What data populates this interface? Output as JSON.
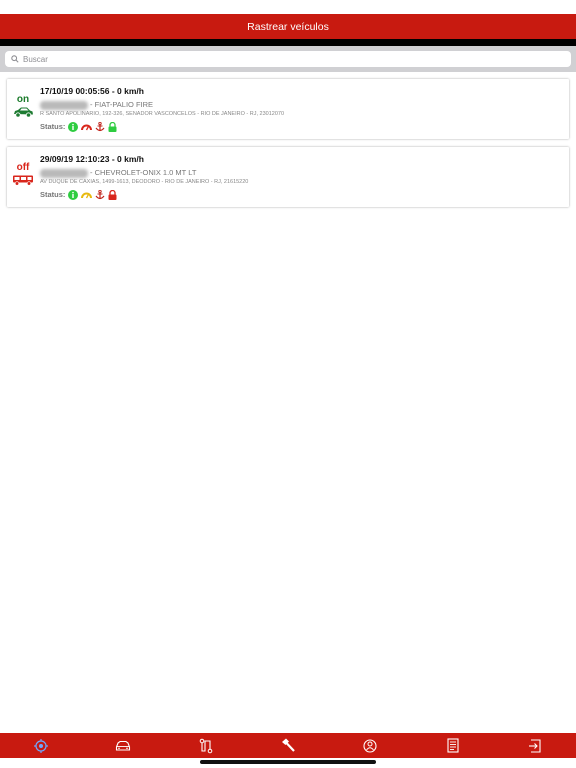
{
  "navbar": {
    "title": "Rastrear veículos"
  },
  "search": {
    "placeholder": "Buscar",
    "icon": "search-icon"
  },
  "vehicles": [
    {
      "state": "on",
      "state_color": "#1a7a2a",
      "datetime": "17/10/19 00:05:56 - 0 km/h",
      "model": "- FIAT-PALIO FIRE",
      "address": "R SANTO APOLINARIO, 192-326, SENADOR VASCONCELOS - RIO DE JANEIRO - RJ, 23012070",
      "status_label": "Status:",
      "status_icons": [
        "info-icon-green",
        "speedometer-icon-red",
        "anchor-icon-red",
        "lock-icon-green"
      ]
    },
    {
      "state": "off",
      "state_color": "#d9261c",
      "datetime": "29/09/19 12:10:23 - 0 km/h",
      "model": "- CHEVROLET-ONIX 1.0 MT LT",
      "address": "AV DUQUE DE CAXIAS, 1499-1613, DEODORO - RIO DE JANEIRO - RJ, 21615220",
      "status_label": "Status:",
      "status_icons": [
        "info-icon-green",
        "speedometer-icon-yellow",
        "anchor-icon-red",
        "lock-icon-red"
      ]
    }
  ],
  "tabbar": {
    "items": [
      "locate-icon",
      "car-icon",
      "route-icon",
      "hammer-icon",
      "driver-icon",
      "report-icon",
      "logout-icon"
    ]
  },
  "colors": {
    "brand_red": "#c81a10",
    "green": "#2ecc40",
    "red": "#d9261c",
    "yellow": "#f0c419"
  }
}
